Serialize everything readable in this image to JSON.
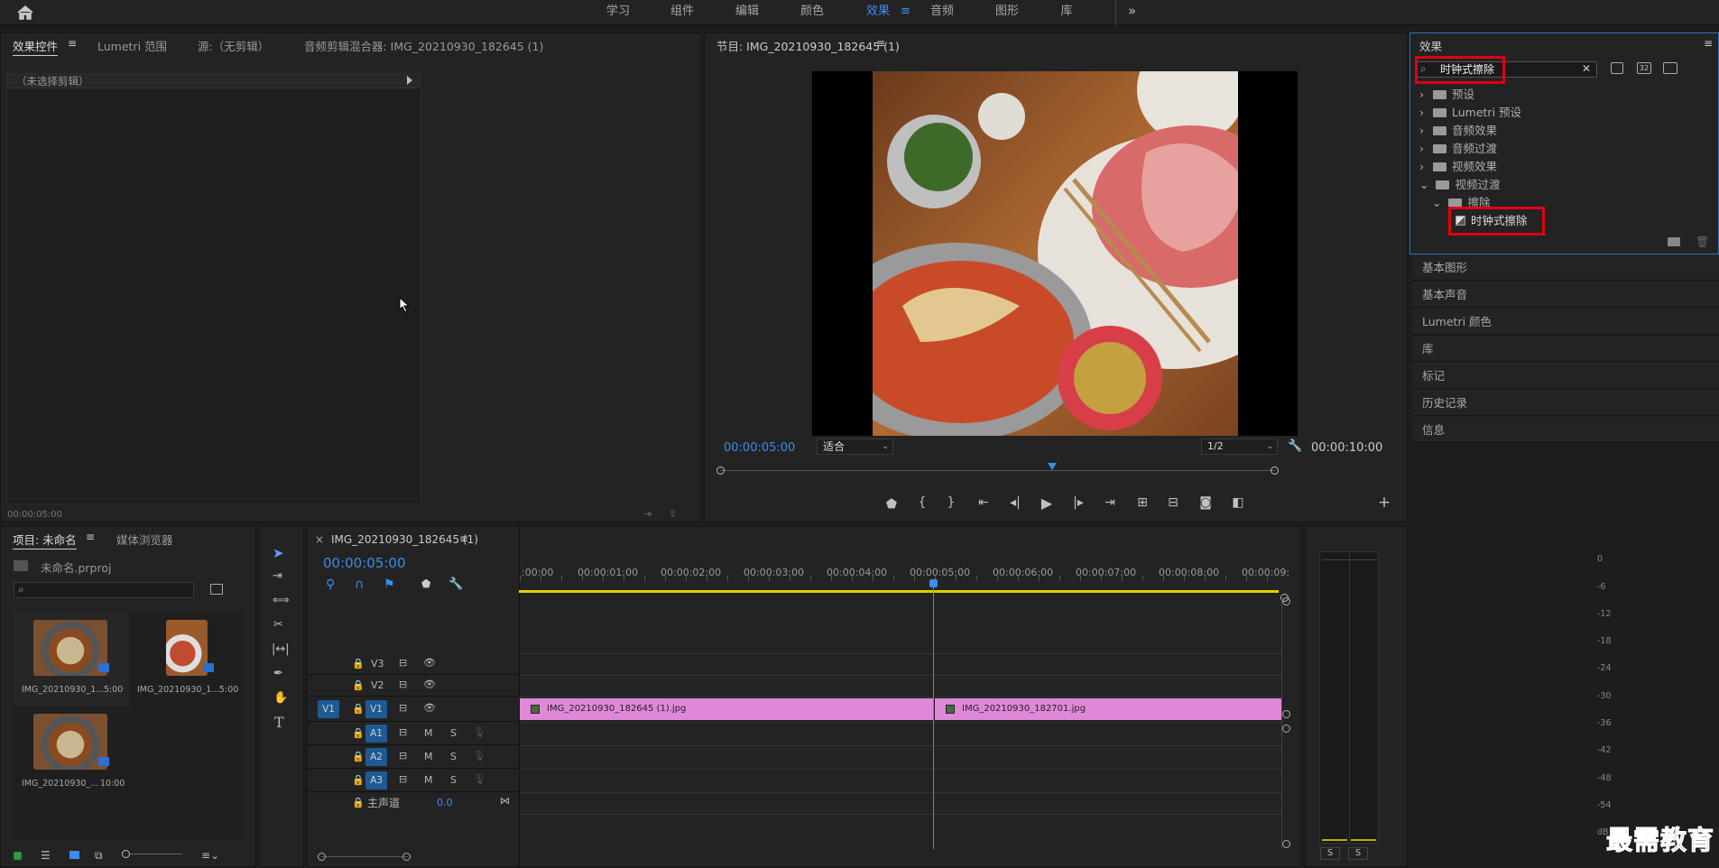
{
  "top_tabs": [
    "学习",
    "组件",
    "编辑",
    "颜色",
    "效果",
    "音频",
    "图形",
    "库"
  ],
  "top_active": "效果",
  "left_tabs": {
    "effect_controls": "效果控件",
    "lumetri_scope": "Lumetri 范围",
    "source": "源:（无剪辑）",
    "audio_mixer": "音频剪辑混合器: IMG_20210930_182645 (1)"
  },
  "effect_controls": {
    "no_clip": "（未选择剪辑）",
    "timecode": "00:00:05:00"
  },
  "program": {
    "title": "节目: IMG_20210930_182645 (1)",
    "timecode": "00:00:05:00",
    "fit": "适合",
    "resolution": "1/2",
    "duration": "00:00:10:00"
  },
  "effects_panel": {
    "title": "效果",
    "search_value": "时钟式擦除",
    "tree": [
      {
        "label": "预设",
        "type": "bin"
      },
      {
        "label": "Lumetri 预设",
        "type": "bin"
      },
      {
        "label": "音频效果",
        "type": "folder"
      },
      {
        "label": "音频过渡",
        "type": "folder"
      },
      {
        "label": "视频效果",
        "type": "folder"
      },
      {
        "label": "视频过渡",
        "type": "folder"
      },
      {
        "label": "擦除",
        "type": "folder"
      },
      {
        "label": "时钟式擦除",
        "type": "effect"
      }
    ]
  },
  "side_sections": [
    "基本图形",
    "基本声音",
    "Lumetri 颜色",
    "库",
    "标记",
    "历史记录",
    "信息"
  ],
  "project": {
    "tab": "项目: 未命名",
    "media_tab": "媒体浏览器",
    "file": "未命名.prproj",
    "items": [
      {
        "name": "IMG_20210930_1...",
        "duration": "5:00"
      },
      {
        "name": "IMG_20210930_1...",
        "duration": "5:00"
      },
      {
        "name": "IMG_20210930_...",
        "duration": "10:00"
      }
    ]
  },
  "timeline": {
    "title": "IMG_20210930_182645 (1)",
    "close": "×",
    "timecode": "00:00:05:00",
    "ruler": [
      ":00:00",
      "00:00:01:00",
      "00:00:02:00",
      "00:00:03:00",
      "00:00:04:00",
      "00:00:05:00",
      "00:00:06:00",
      "00:00:07:00",
      "00:00:08:00",
      "00:00:09:"
    ],
    "tracks": {
      "v3": "V3",
      "v2": "V2",
      "v1": "V1",
      "a1": "A1",
      "a2": "A2",
      "a3": "A3",
      "m": "M",
      "s": "S"
    },
    "master": "主声道",
    "master_val": "0.0",
    "clip1": "IMG_20210930_182645 (1).jpg",
    "clip2": "IMG_20210930_182701.jpg"
  },
  "meter": {
    "labels": [
      "0",
      "-6",
      "-12",
      "-18",
      "-24",
      "-30",
      "-36",
      "-42",
      "-48",
      "-54",
      "dB"
    ],
    "solo": "S"
  },
  "watermark": "最需教育",
  "colors": {
    "accent": "#3c8cf0",
    "clip": "#df88d8",
    "highlight": "#e00012",
    "playhead": "#3c8cf0",
    "work_area": "#e0d000"
  }
}
